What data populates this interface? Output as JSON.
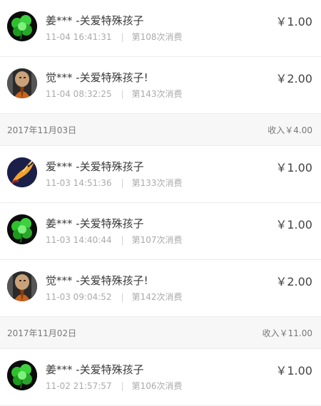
{
  "items": [
    {
      "kind": "tx",
      "avatar": "green-clover",
      "name": "姜*** -关爱特殊孩子",
      "time": "11-04 16:41:31",
      "sep": "|",
      "count": "第108次消费",
      "amount": "￥1.00"
    },
    {
      "kind": "tx",
      "avatar": "monk",
      "name": "觉*** -关爱特殊孩子!",
      "time": "11-04 08:32:25",
      "sep": "|",
      "count": "第143次消费",
      "amount": "￥2.00"
    },
    {
      "kind": "date",
      "date": "2017年11月03日",
      "income": "收入￥4.00"
    },
    {
      "kind": "tx",
      "avatar": "koi-fish",
      "name": "爱*** -关爱特殊孩子",
      "time": "11-03 14:51:36",
      "sep": "|",
      "count": "第133次消费",
      "amount": "￥1.00"
    },
    {
      "kind": "tx",
      "avatar": "green-clover",
      "name": "姜*** -关爱特殊孩子",
      "time": "11-03 14:40:44",
      "sep": "|",
      "count": "第107次消费",
      "amount": "￥1.00"
    },
    {
      "kind": "tx",
      "avatar": "monk",
      "name": "觉*** -关爱特殊孩子!",
      "time": "11-03 09:04:52",
      "sep": "|",
      "count": "第142次消费",
      "amount": "￥2.00"
    },
    {
      "kind": "date",
      "date": "2017年11月02日",
      "income": "收入￥11.00"
    },
    {
      "kind": "tx",
      "avatar": "green-clover",
      "name": "姜*** -关爱特殊孩子",
      "time": "11-02 21:57:57",
      "sep": "|",
      "count": "第106次消费",
      "amount": "￥1.00"
    }
  ]
}
